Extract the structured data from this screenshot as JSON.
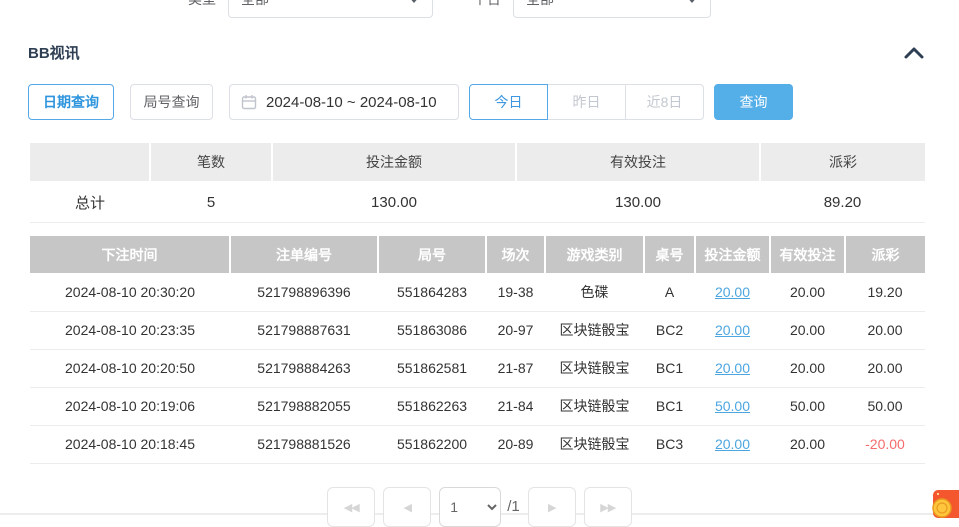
{
  "top_filters": {
    "type": {
      "label": "类型",
      "value": "全部"
    },
    "platform": {
      "label": "平台",
      "value": "全部"
    }
  },
  "section": {
    "title": "BB视讯"
  },
  "query_bar": {
    "date_tab": "日期查询",
    "round_tab": "局号查询",
    "date_range": "2024-08-10 ~ 2024-08-10",
    "quick_today": "今日",
    "quick_yesterday": "昨日",
    "quick_last8": "近8日",
    "search": "查询"
  },
  "summary_table": {
    "headers": [
      "",
      "笔数",
      "投注金额",
      "有效投注",
      "派彩"
    ],
    "row": {
      "label": "总计",
      "count": "5",
      "bet_amount": "130.00",
      "valid_bet": "130.00",
      "payout": "89.20"
    }
  },
  "records_table": {
    "headers": [
      "下注时间",
      "注单编号",
      "局号",
      "场次",
      "游戏类别",
      "桌号",
      "投注金额",
      "有效投注",
      "派彩"
    ],
    "rows": [
      [
        "2024-08-10 20:30:20",
        "521798896396",
        "551864283",
        "19-38",
        "色碟",
        "A",
        "20.00",
        "20.00",
        "19.20"
      ],
      [
        "2024-08-10 20:23:35",
        "521798887631",
        "551863086",
        "20-97",
        "区块链骰宝",
        "BC2",
        "20.00",
        "20.00",
        "20.00"
      ],
      [
        "2024-08-10 20:20:50",
        "521798884263",
        "551862581",
        "21-87",
        "区块链骰宝",
        "BC1",
        "20.00",
        "20.00",
        "20.00"
      ],
      [
        "2024-08-10 20:19:06",
        "521798882055",
        "551862263",
        "21-84",
        "区块链骰宝",
        "BC1",
        "50.00",
        "50.00",
        "50.00"
      ],
      [
        "2024-08-10 20:18:45",
        "521798881526",
        "551862200",
        "20-89",
        "区块链骰宝",
        "BC3",
        "20.00",
        "20.00",
        "-20.00"
      ]
    ]
  },
  "pagination": {
    "nav": [
      "◀◀",
      "◀",
      "▶",
      "▶▶"
    ],
    "current_page": "1",
    "total_label": "/1"
  },
  "icons": {
    "calendar-icon": "calendar outline glyph",
    "chevron-up-icon": "^",
    "chevron-down-icon": "▼",
    "customer-service-icon": "orange badge with gold coin"
  },
  "colors": {
    "accent_blue": "#54a8e8",
    "link_blue": "#4da6e0",
    "negative_red": "#f56c6c",
    "title_navy": "#2e3f54",
    "records_header_bg": "#c6c6c6",
    "summary_header_bg": "#ececec"
  }
}
